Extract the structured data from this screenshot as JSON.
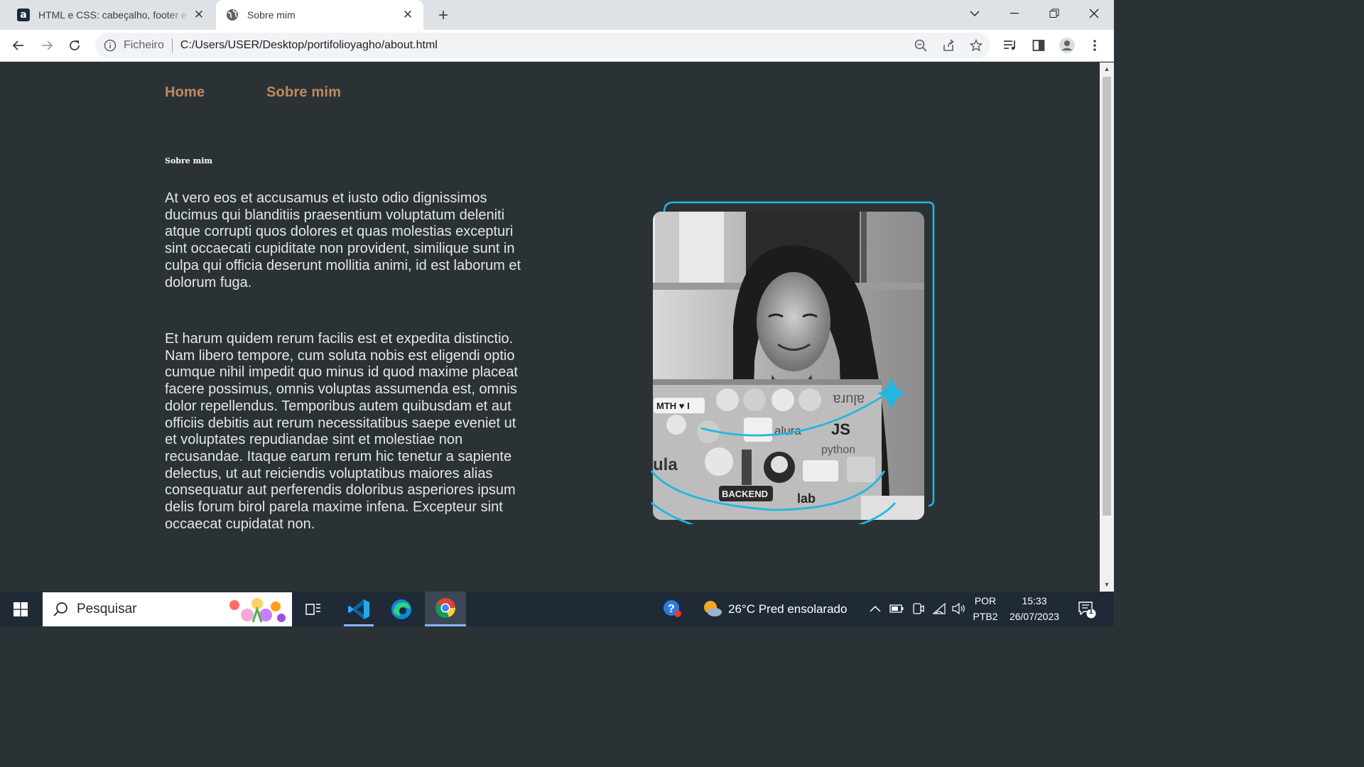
{
  "browser": {
    "tabs": [
      {
        "title": "HTML e CSS: cabeçalho, footer e",
        "favicon": "alura-a-icon",
        "active": false
      },
      {
        "title": "Sobre mim",
        "favicon": "globe-icon",
        "active": true
      }
    ],
    "address": {
      "scheme_label": "Ficheiro",
      "url": "C:/Users/USER/Desktop/portifolioyagho/about.html"
    }
  },
  "page": {
    "nav": [
      {
        "label": "Home"
      },
      {
        "label": "Sobre mim"
      }
    ],
    "section_title": "Sobre mim",
    "paragraphs": [
      "At vero eos et accusamus et iusto odio dignissimos ducimus qui blanditiis praesentium voluptatum deleniti atque corrupti quos dolores et quas molestias excepturi sint occaecati cupiditate non provident, similique sunt in culpa qui officia deserunt mollitia animi, id est laborum et dolorum fuga.",
      "Et harum quidem rerum facilis est et expedita distinctio. Nam libero tempore, cum soluta nobis est eligendi optio cumque nihil impedit quo minus id quod maxime placeat facere possimus, omnis voluptas assumenda est, omnis dolor repellendus. Temporibus autem quibusdam et aut officiis debitis aut rerum necessitatibus saepe eveniet ut et voluptates repudiandae sint et molestiae non recusandae. Itaque earum rerum hic tenetur a sapiente delectus, ut aut reiciendis voluptatibus maiores alias consequatur aut perferendis doloribus asperiores ipsum delis forum birol parela maxime infena. Excepteur sint occaecat cupidatat non."
    ],
    "photo": {
      "sticker_texts": [
        "MTH ♥ I",
        "alura",
        "alura",
        "JS",
        "python",
        "ula",
        "BACKEND",
        "lab"
      ]
    },
    "colors": {
      "background": "#2b3236",
      "nav_link": "#c08a5e",
      "accent_cyan": "#1fb8e0"
    }
  },
  "taskbar": {
    "search_placeholder": "Pesquisar",
    "weather": "26°C  Pred ensolarado",
    "language": "POR",
    "keyboard": "PTB2",
    "time": "15:33",
    "date": "26/07/2023",
    "notification_count": "1"
  }
}
